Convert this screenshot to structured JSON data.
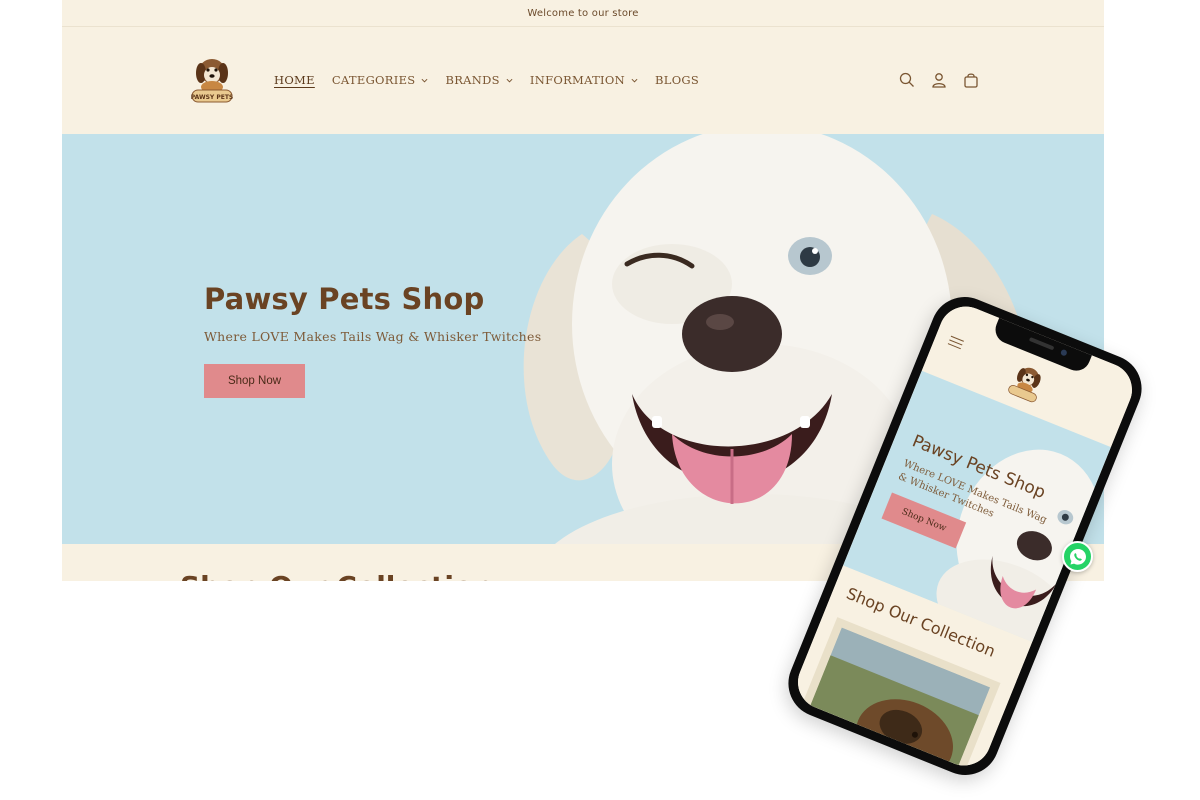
{
  "announcement": "Welcome to our store",
  "brand": {
    "logo_icon": "pawsy-pets-dog-logo",
    "logo_text": "PAWSY PETS"
  },
  "nav": {
    "items": [
      {
        "label": "HOME",
        "active": true,
        "dropdown": false
      },
      {
        "label": "CATEGORIES",
        "active": false,
        "dropdown": true
      },
      {
        "label": "BRANDS",
        "active": false,
        "dropdown": true
      },
      {
        "label": "INFORMATION",
        "active": false,
        "dropdown": true
      },
      {
        "label": "BLOGS",
        "active": false,
        "dropdown": false
      }
    ]
  },
  "header_icons": [
    "search-icon",
    "account-icon",
    "cart-icon"
  ],
  "hero": {
    "title": "Pawsy Pets Shop",
    "subtitle": "Where LOVE Makes Tails Wag & Whisker Twitches",
    "button_label": "Shop Now"
  },
  "collection": {
    "title": "Shop Our Collection"
  },
  "mobile": {
    "hero_title": "Pawsy Pets Shop",
    "hero_subtitle": "Where LOVE Makes Tails Wag & Whisker Twitches",
    "button_label": "Shop Now",
    "collection_title": "Shop Our Collection",
    "menu_icon": "hamburger-menu-icon"
  },
  "floating": {
    "whatsapp_icon": "whatsapp-icon"
  },
  "colors": {
    "background": "#f8f1e2",
    "hero_background": "#c2e1ea",
    "brand_brown": "#6a4323",
    "button_pink": "#e08a8c",
    "whatsapp_green": "#25d366"
  }
}
